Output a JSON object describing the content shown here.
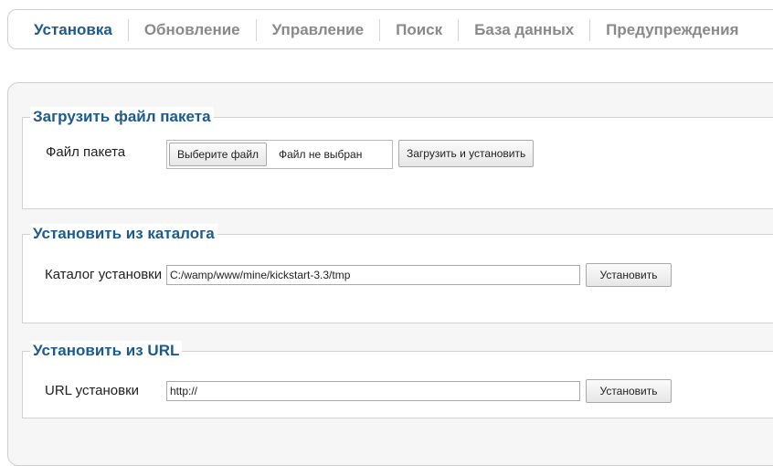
{
  "tabs": [
    {
      "label": "Установка",
      "active": true
    },
    {
      "label": "Обновление",
      "active": false
    },
    {
      "label": "Управление",
      "active": false
    },
    {
      "label": "Поиск",
      "active": false
    },
    {
      "label": "База данных",
      "active": false
    },
    {
      "label": "Предупреждения",
      "active": false
    }
  ],
  "upload": {
    "legend": "Загрузить файл пакета",
    "label": "Файл пакета",
    "choose_button": "Выберите файл",
    "file_status": "Файл не выбран",
    "submit_button": "Загрузить и установить"
  },
  "directory": {
    "legend": "Установить из каталога",
    "label": "Каталог установки",
    "value": "C:/wamp/www/mine/kickstart-3.3/tmp",
    "submit_button": "Установить"
  },
  "url": {
    "legend": "Установить из URL",
    "label": "URL установки",
    "value": "http://",
    "submit_button": "Установить"
  },
  "colors": {
    "accent": "#1f5a8c",
    "tab_inactive": "#8a8a8a",
    "panel_background": "#f6f6f6",
    "border": "#cfcfcf"
  }
}
